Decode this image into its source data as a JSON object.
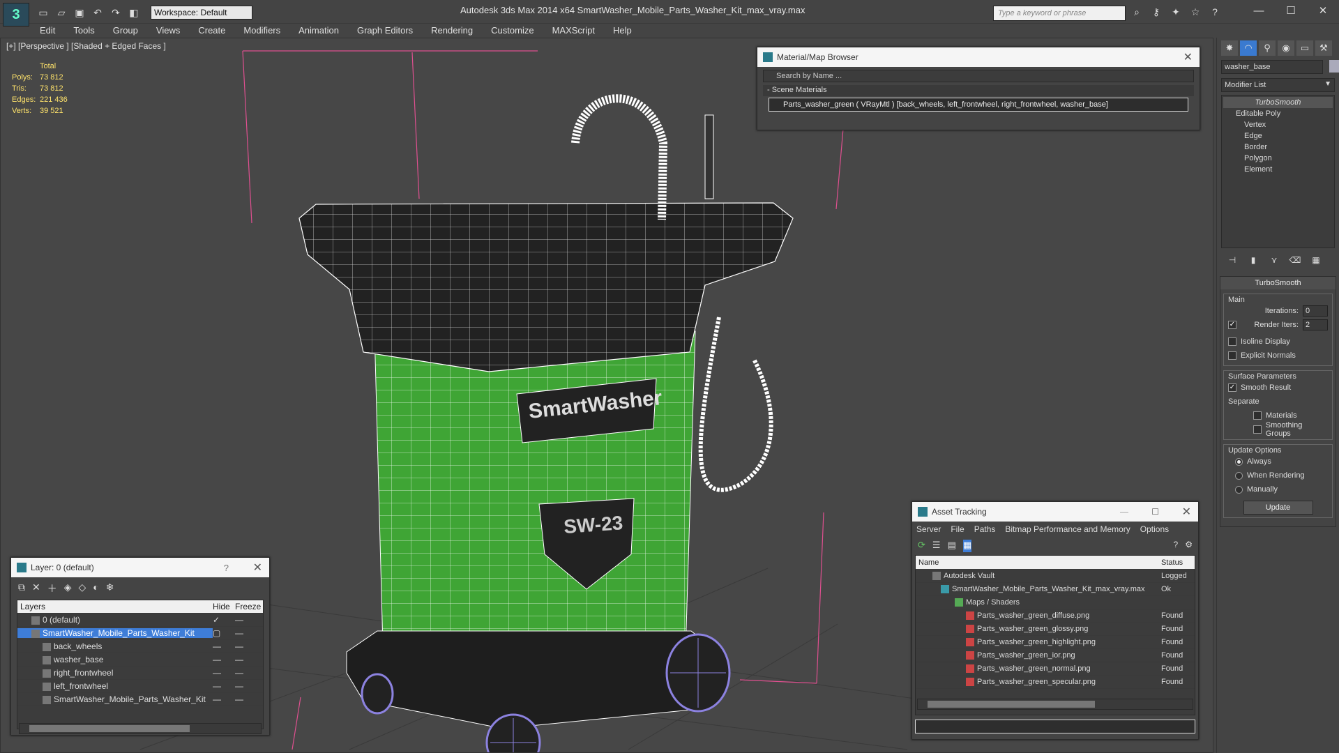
{
  "app": {
    "window_title": "Autodesk 3ds Max  2014 x64      SmartWasher_Mobile_Parts_Washer_Kit_max_vray.max",
    "workspace": "Workspace: Default",
    "search_placeholder": "Type a keyword or phrase"
  },
  "menu": [
    "Edit",
    "Tools",
    "Group",
    "Views",
    "Create",
    "Modifiers",
    "Animation",
    "Graph Editors",
    "Rendering",
    "Customize",
    "MAXScript",
    "Help"
  ],
  "viewport": {
    "label": "[+] [Perspective ] [Shaded + Edged Faces ]",
    "stats_header": "Total",
    "stats": [
      {
        "k": "Polys:",
        "v": "73 812"
      },
      {
        "k": "Tris:",
        "v": "73 812"
      },
      {
        "k": "Edges:",
        "v": "221 436"
      },
      {
        "k": "Verts:",
        "v": "39 521"
      }
    ],
    "brand_text": "SmartWasher",
    "model_text": "SW-23"
  },
  "material_browser": {
    "title": "Material/Map Browser",
    "search": "Search by Name ...",
    "section": "- Scene Materials",
    "item": "Parts_washer_green  ( VRayMtl ) [back_wheels, left_frontwheel, right_frontwheel, washer_base]"
  },
  "command_panel": {
    "object_name": "washer_base",
    "modifier_list": "Modifier List",
    "stack": [
      "TurboSmooth",
      "Editable Poly",
      "Vertex",
      "Edge",
      "Border",
      "Polygon",
      "Element"
    ],
    "turbosmooth": {
      "title": "TurboSmooth",
      "main": "Main",
      "iterations_label": "Iterations:",
      "iterations": "0",
      "render_iters_label": "Render Iters:",
      "render_iters": "2",
      "isoline": "Isoline Display",
      "explicit": "Explicit Normals",
      "surface_params": "Surface Parameters",
      "smooth_result": "Smooth Result",
      "separate": "Separate",
      "materials": "Materials",
      "smoothing_groups": "Smoothing Groups",
      "update_options": "Update Options",
      "always": "Always",
      "when_rendering": "When Rendering",
      "manually": "Manually",
      "update": "Update"
    }
  },
  "layer_panel": {
    "title": "Layer: 0 (default)",
    "help": "?",
    "col_layers": "Layers",
    "col_hide": "Hide",
    "col_freeze": "Freeze",
    "rows": [
      {
        "name": "0 (default)",
        "indent": 1
      },
      {
        "name": "SmartWasher_Mobile_Parts_Washer_Kit",
        "indent": 1,
        "selected": true
      },
      {
        "name": "back_wheels",
        "indent": 2
      },
      {
        "name": "washer_base",
        "indent": 2
      },
      {
        "name": "right_frontwheel",
        "indent": 2
      },
      {
        "name": "left_frontwheel",
        "indent": 2
      },
      {
        "name": "SmartWasher_Mobile_Parts_Washer_Kit",
        "indent": 2
      }
    ]
  },
  "asset_tracking": {
    "title": "Asset Tracking",
    "menu": [
      "Server",
      "File",
      "Paths",
      "Bitmap Performance and Memory",
      "Options"
    ],
    "col_name": "Name",
    "col_status": "Status",
    "rows": [
      {
        "name": "Autodesk Vault",
        "status": "Logged",
        "indent": 1
      },
      {
        "name": "SmartWasher_Mobile_Parts_Washer_Kit_max_vray.max",
        "status": "Ok",
        "indent": 2
      },
      {
        "name": "Maps / Shaders",
        "status": "",
        "indent": 3
      },
      {
        "name": "Parts_washer_green_diffuse.png",
        "status": "Found",
        "indent": 4
      },
      {
        "name": "Parts_washer_green_glossy.png",
        "status": "Found",
        "indent": 4
      },
      {
        "name": "Parts_washer_green_highlight.png",
        "status": "Found",
        "indent": 4
      },
      {
        "name": "Parts_washer_green_ior.png",
        "status": "Found",
        "indent": 4
      },
      {
        "name": "Parts_washer_green_normal.png",
        "status": "Found",
        "indent": 4
      },
      {
        "name": "Parts_washer_green_specular.png",
        "status": "Found",
        "indent": 4
      }
    ]
  },
  "colors": {
    "accent": "#3e7dd8",
    "stats": "#ffe36b",
    "model_green": "#3fa535",
    "wire": "#ffffff"
  }
}
